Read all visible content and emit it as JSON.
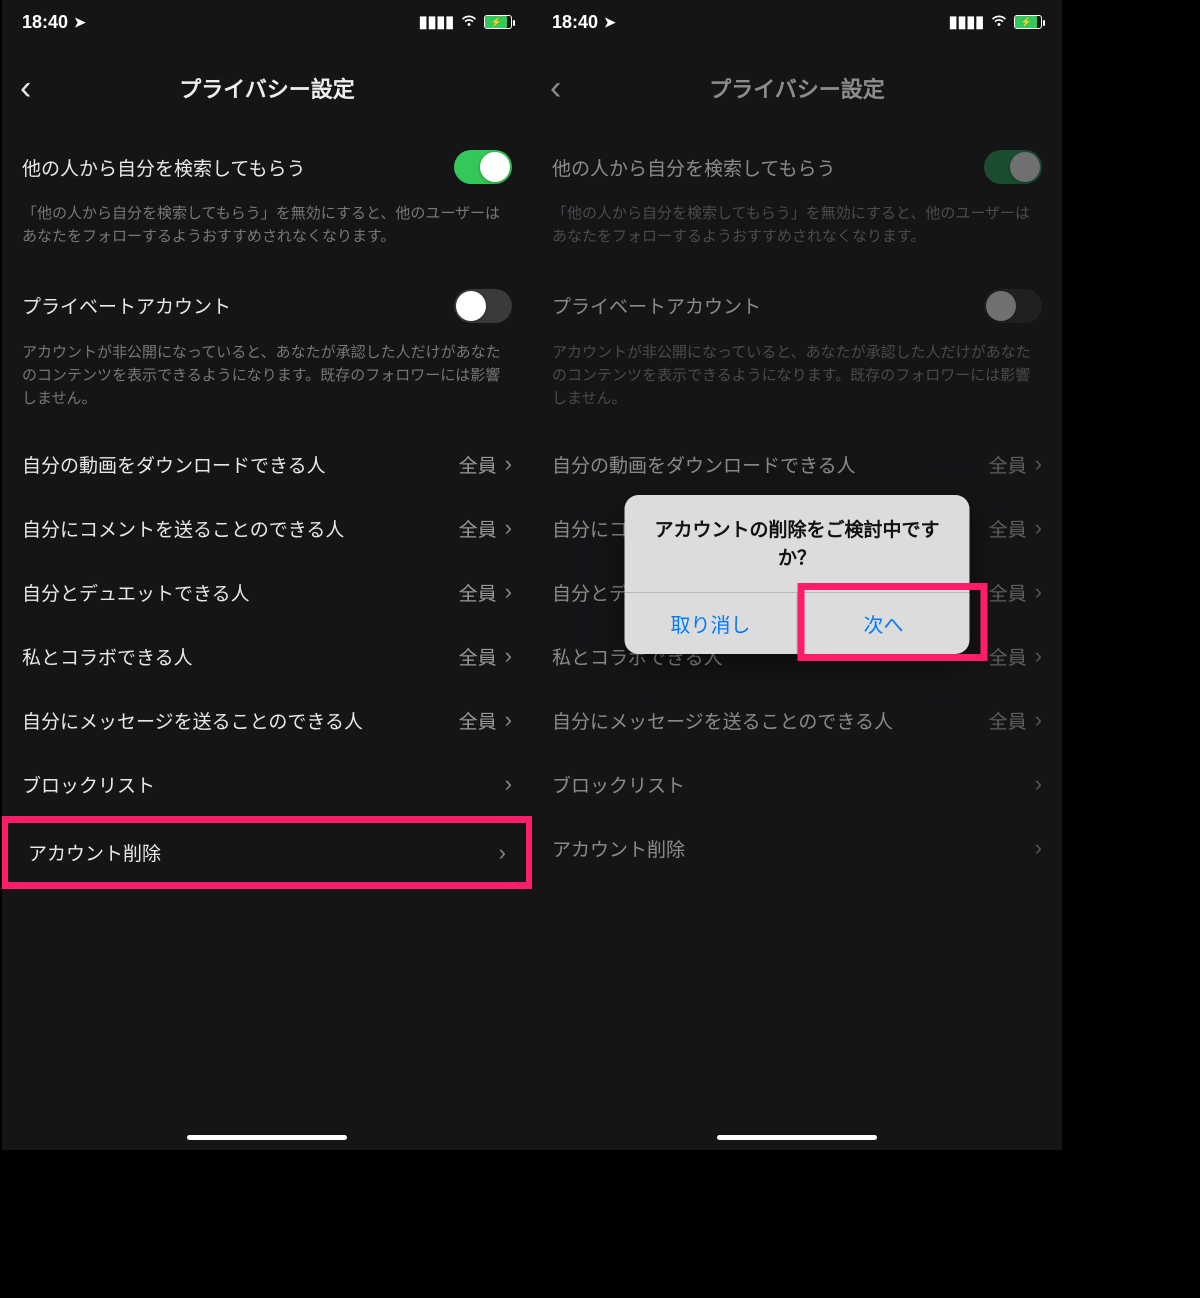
{
  "status": {
    "time": "18:40"
  },
  "header": {
    "title": "プライバシー設定"
  },
  "rows": {
    "search": {
      "label": "他の人から自分を検索してもらう"
    },
    "search_desc": "「他の人から自分を検索してもらう」を無効にすると、他のユーザーはあなたをフォローするようおすすめされなくなります。",
    "private": {
      "label": "プライベートアカウント"
    },
    "private_desc": "アカウントが非公開になっていると、あなたが承認した人だけがあなたのコンテンツを表示できるようになります。既存のフォロワーには影響しません。",
    "download": {
      "label": "自分の動画をダウンロードできる人",
      "value": "全員"
    },
    "comment": {
      "label": "自分にコメントを送ることのできる人",
      "value": "全員"
    },
    "duet": {
      "label": "自分とデュエットできる人",
      "value": "全員"
    },
    "collab": {
      "label": "私とコラボできる人",
      "value": "全員"
    },
    "message": {
      "label": "自分にメッセージを送ることのできる人",
      "value": "全員"
    },
    "blocklist": {
      "label": "ブロックリスト"
    },
    "delete": {
      "label": "アカウント削除"
    }
  },
  "dialog": {
    "message": "アカウントの削除をご検討中ですか？",
    "cancel": "取り消し",
    "next": "次へ"
  }
}
